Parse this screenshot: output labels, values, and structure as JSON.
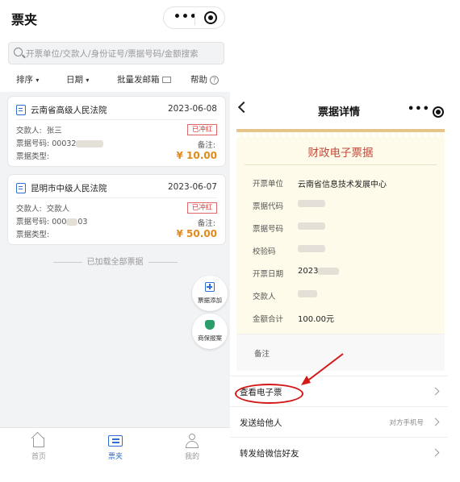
{
  "left": {
    "title": "票夹",
    "search_placeholder": "开票单位/交款人/身份证号/票据号码/金额搜索",
    "filter": {
      "sort": "排序",
      "date": "日期",
      "batch": "批量发邮箱",
      "help": "帮助"
    },
    "cards": [
      {
        "name": "云南省高级人民法院",
        "date": "2023-06-08",
        "payer_label": "交款人:",
        "payer": "张三",
        "no_label": "票据号码:",
        "no": "00032",
        "type_label": "票据类型:",
        "stamp": "已冲红",
        "remark": "备注:",
        "amount": "¥ 10.00"
      },
      {
        "name": "昆明市中级人民法院",
        "date": "2023-06-07",
        "payer_label": "交款人:",
        "payer": "交款人",
        "no_label": "票据号码:",
        "no": "000",
        "no_tail": "03",
        "type_label": "票据类型:",
        "stamp": "已冲红",
        "remark": "备注:",
        "amount": "¥ 50.00"
      }
    ],
    "loaded_text": "已加载全部票据",
    "float_add": "票据添加",
    "float_insure": "商保报案",
    "tabs": [
      {
        "label": "首页"
      },
      {
        "label": "票夹"
      },
      {
        "label": "我的"
      }
    ]
  },
  "right": {
    "title": "票据详情",
    "receipt_title": "财政电子票据",
    "fields": [
      {
        "label": "开票单位",
        "value": "云南省信息技术发展中心"
      },
      {
        "label": "票据代码",
        "value": ""
      },
      {
        "label": "票据号码",
        "value": ""
      },
      {
        "label": "校验码",
        "value": ""
      },
      {
        "label": "开票日期",
        "value": "2023"
      },
      {
        "label": "交款人",
        "value": ""
      },
      {
        "label": "金额合计",
        "value": "100.00元"
      }
    ],
    "remark_label": "备注",
    "actions": [
      {
        "label": "查看电子票",
        "hint": ""
      },
      {
        "label": "发送给他人",
        "hint": "对方手机号"
      },
      {
        "label": "转发给微信好友",
        "hint": ""
      }
    ]
  },
  "colors": {
    "accent": "#2f6fd1",
    "amount": "#e08a1c",
    "stamp": "#d33333",
    "annotation": "#d31818"
  }
}
